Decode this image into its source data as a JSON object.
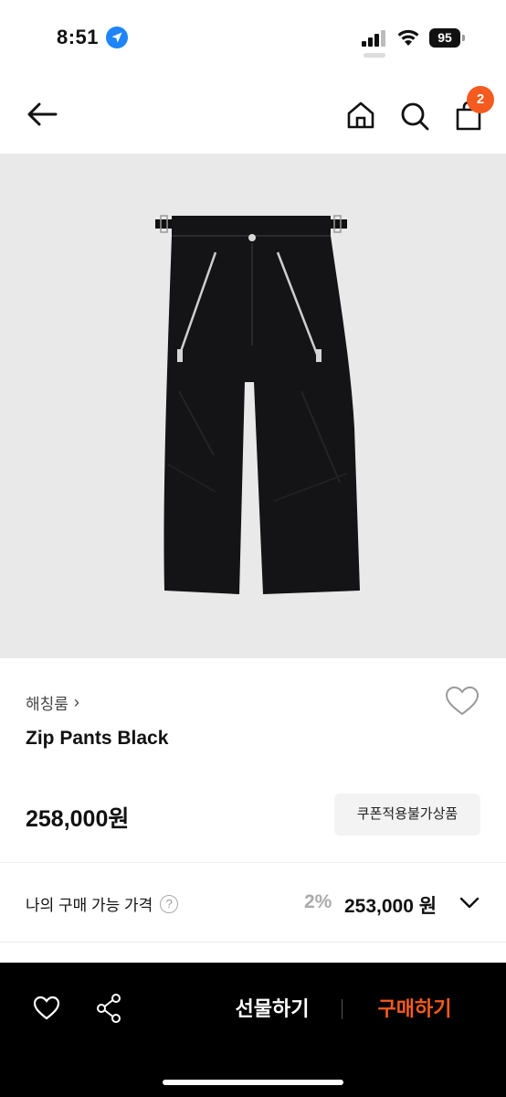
{
  "status_bar": {
    "time": "8:51",
    "battery": "95"
  },
  "header": {
    "cart_count": "2"
  },
  "product": {
    "brand": "해칭룸",
    "brand_chevron": "›",
    "name": "Zip Pants Black",
    "price": "258,000원",
    "coupon_note": "쿠폰적용불가상품"
  },
  "my_price": {
    "label": "나의 구매 가능 가격",
    "help": "?",
    "discount": "2%",
    "price": "253,000 원"
  },
  "bottom_bar": {
    "gift_label": "선물하기",
    "buy_label": "구매하기"
  },
  "colors": {
    "accent": "#f55a1f",
    "image_bg": "#e9e9ea",
    "bar_bg": "#000000"
  },
  "icons": [
    "location-arrow-icon",
    "signal-icon",
    "wifi-icon",
    "battery-icon",
    "back-arrow-icon",
    "home-icon",
    "search-icon",
    "shopping-bag-icon",
    "heart-outline-icon",
    "help-circle-icon",
    "chevron-down-icon",
    "share-icon"
  ]
}
